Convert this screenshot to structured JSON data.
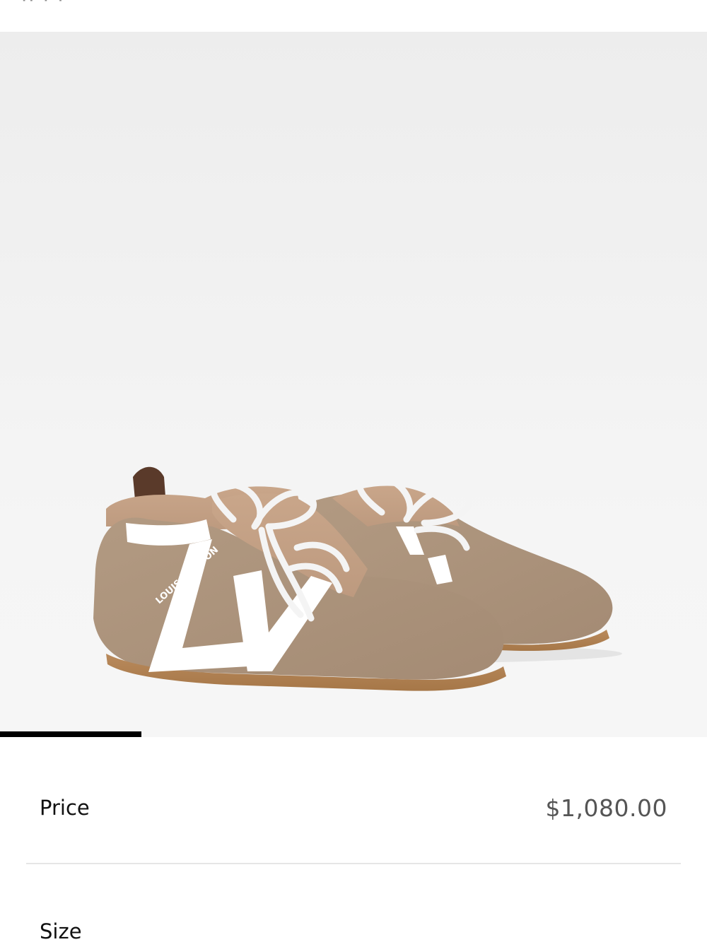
{
  "header": {
    "partial_title": "·· · ·"
  },
  "gallery": {
    "product_image": "sneaker-image",
    "brand_print_on_shoe": "LOUIS VUITTON",
    "image_progress": 0.2,
    "background_color": "#f0f0f0"
  },
  "details": {
    "price_label": "Price",
    "price_value": "$1,080.00",
    "size_label": "Size"
  },
  "colors": {
    "text_primary": "#111111",
    "text_secondary": "#555555",
    "progress": "#000000",
    "divider": "#e6e6e6"
  }
}
